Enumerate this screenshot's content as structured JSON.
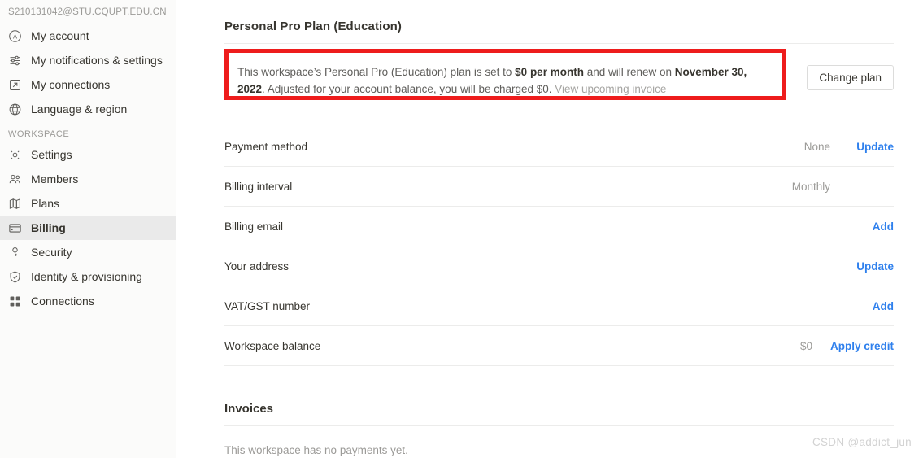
{
  "sidebar": {
    "account_email": "S210131042@STU.CQUPT.EDU.CN",
    "personal_items": [
      {
        "label": "My account",
        "icon": "account-circle-icon"
      },
      {
        "label": "My notifications & settings",
        "icon": "sliders-icon"
      },
      {
        "label": "My connections",
        "icon": "arrow-out-box-icon"
      },
      {
        "label": "Language & region",
        "icon": "globe-icon"
      }
    ],
    "workspace_section_label": "WORKSPACE",
    "workspace_items": [
      {
        "label": "Settings",
        "icon": "gear-icon",
        "active": false
      },
      {
        "label": "Members",
        "icon": "people-icon",
        "active": false
      },
      {
        "label": "Plans",
        "icon": "map-icon",
        "active": false
      },
      {
        "label": "Billing",
        "icon": "credit-card-icon",
        "active": true
      },
      {
        "label": "Security",
        "icon": "key-icon",
        "active": false
      },
      {
        "label": "Identity & provisioning",
        "icon": "shield-check-icon",
        "active": false
      },
      {
        "label": "Connections",
        "icon": "grid-icon",
        "active": false
      }
    ]
  },
  "main": {
    "page_title": "Personal Pro Plan (Education)",
    "notice": {
      "part1": "This workspace’s Personal Pro (Education) plan is set to ",
      "bold1": "$0 per month",
      "part2": " and will renew on ",
      "bold2": "November 30, 2022",
      "part3": ". Adjusted for your account balance, you will be charged $0. ",
      "link": "View upcoming invoice",
      "highlight_color": "#ee1c1c"
    },
    "change_plan_label": "Change plan",
    "rows": [
      {
        "label": "Payment method",
        "value": "None",
        "action": "Update"
      },
      {
        "label": "Billing interval",
        "value": "Monthly",
        "action": ""
      },
      {
        "label": "Billing email",
        "value": "",
        "action": "Add"
      },
      {
        "label": "Your address",
        "value": "",
        "action": "Update"
      },
      {
        "label": "VAT/GST number",
        "value": "",
        "action": "Add"
      },
      {
        "label": "Workspace balance",
        "value": "$0",
        "action": "Apply credit"
      }
    ],
    "invoices": {
      "title": "Invoices",
      "empty_text": "This workspace has no payments yet."
    },
    "accent_color": "#2f80ed"
  },
  "watermark": "CSDN @addict_jun"
}
